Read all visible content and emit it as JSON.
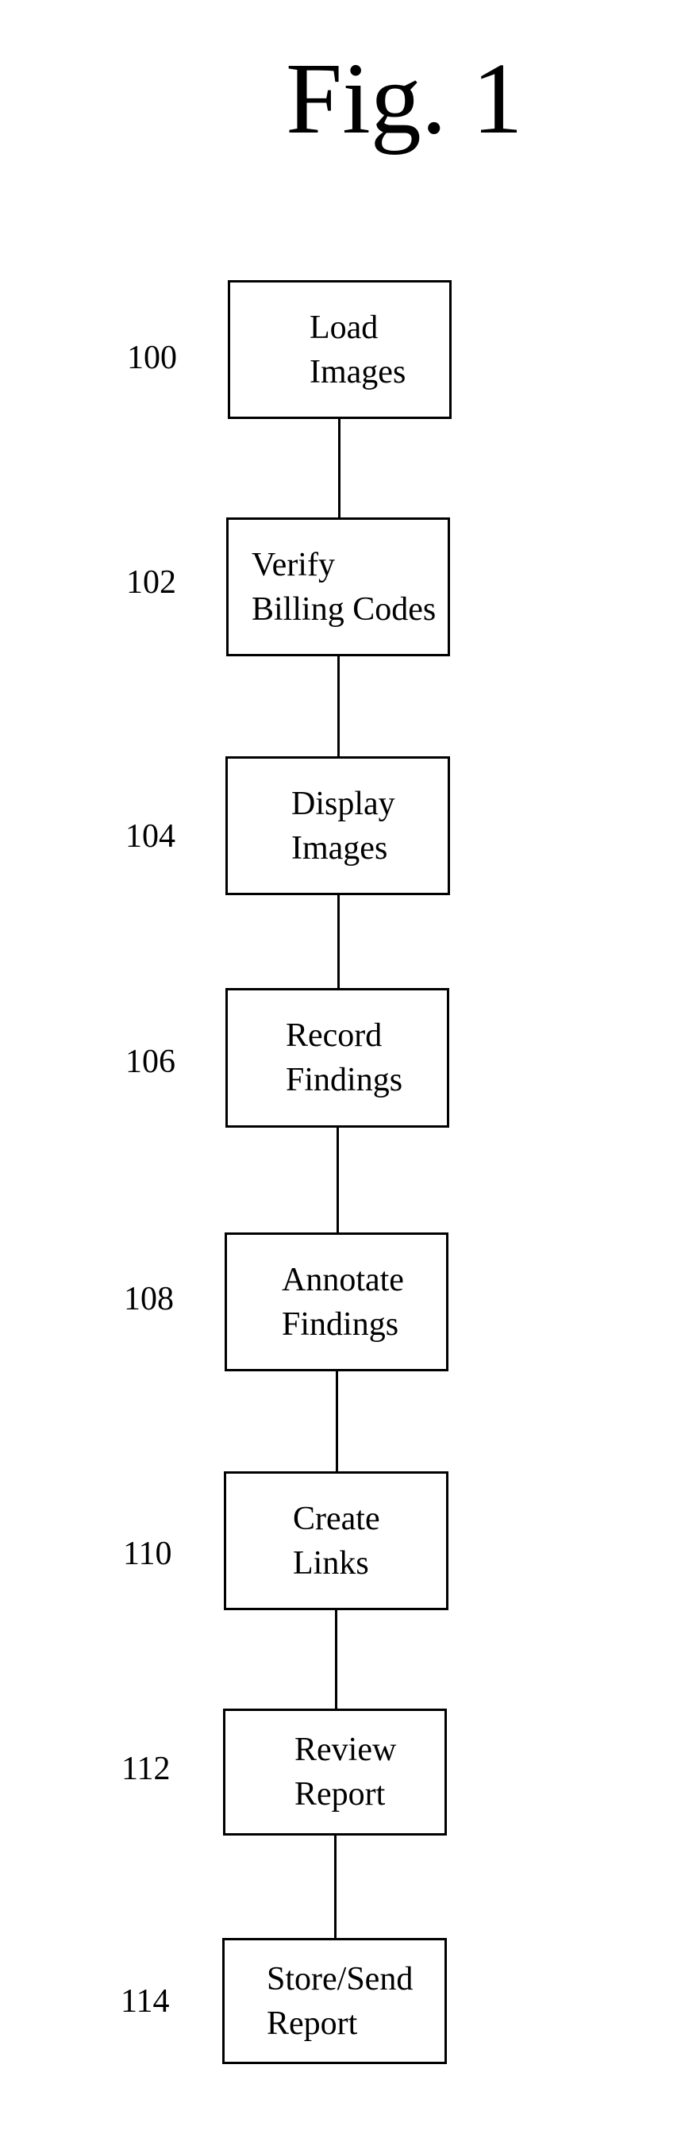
{
  "figure": {
    "title": "Fig. 1",
    "steps": [
      {
        "ref": "100",
        "line1": "Load",
        "line2": "Images"
      },
      {
        "ref": "102",
        "line1": "Verify",
        "line2": "Billing Codes"
      },
      {
        "ref": "104",
        "line1": "Display",
        "line2": "Images"
      },
      {
        "ref": "106",
        "line1": "Record",
        "line2": "Findings"
      },
      {
        "ref": "108",
        "line1": "Annotate",
        "line2": "Findings"
      },
      {
        "ref": "110",
        "line1": "Create",
        "line2": "Links"
      },
      {
        "ref": "112",
        "line1": "Review",
        "line2": "Report"
      },
      {
        "ref": "114",
        "line1": "Store/Send",
        "line2": "Report"
      }
    ]
  }
}
